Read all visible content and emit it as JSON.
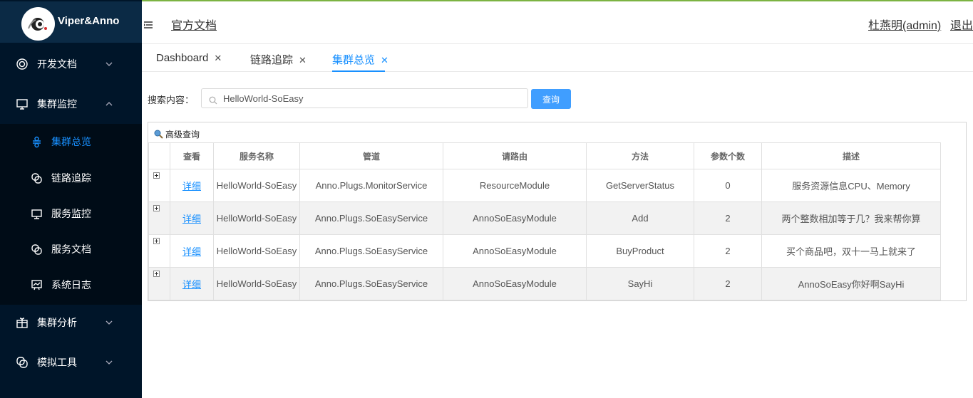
{
  "app": {
    "name": "Viper&Anno"
  },
  "colors": {
    "sidebar_bg": "#001529",
    "accent": "#1890ff",
    "button": "#409eff"
  },
  "sidebar": {
    "items": [
      {
        "label": "开发文档",
        "icon": "settings-circle-icon"
      },
      {
        "label": "集群监控",
        "icon": "monitor-icon",
        "expanded": true
      },
      {
        "label": "集群分析",
        "icon": "gift-icon"
      },
      {
        "label": "模拟工具",
        "icon": "link-icon"
      }
    ],
    "submenu": [
      {
        "label": "集群总览",
        "icon": "cluster-icon",
        "active": true
      },
      {
        "label": "链路追踪",
        "icon": "link-icon"
      },
      {
        "label": "服务监控",
        "icon": "monitor-icon"
      },
      {
        "label": "服务文档",
        "icon": "link-icon"
      },
      {
        "label": "系统日志",
        "icon": "chart-board-icon"
      }
    ]
  },
  "header": {
    "doc_link": "官方文档",
    "user": "杜燕明(admin)",
    "logout": "退出"
  },
  "tabs": [
    {
      "label": "Dashboard"
    },
    {
      "label": "链路追踪"
    },
    {
      "label": "集群总览",
      "active": true
    }
  ],
  "search": {
    "label": "搜索内容：",
    "value": "HelloWorld-SoEasy",
    "button": "查询"
  },
  "grid": {
    "advanced": "高级查询",
    "columns": [
      "查看",
      "服务名称",
      "管道",
      "请路由",
      "方法",
      "参数个数",
      "描述"
    ],
    "rows": [
      {
        "link": "详细",
        "service": "HelloWorld-SoEasy",
        "pipe": "Anno.Plugs.MonitorService",
        "route": "ResourceModule",
        "method": "GetServerStatus",
        "params": "0",
        "desc": "服务资源信息CPU、Memory"
      },
      {
        "link": "详细",
        "service": "HelloWorld-SoEasy",
        "pipe": "Anno.Plugs.SoEasyService",
        "route": "AnnoSoEasyModule",
        "method": "Add",
        "params": "2",
        "desc": "两个整数相加等于几？我来帮你算"
      },
      {
        "link": "详细",
        "service": "HelloWorld-SoEasy",
        "pipe": "Anno.Plugs.SoEasyService",
        "route": "AnnoSoEasyModule",
        "method": "BuyProduct",
        "params": "2",
        "desc": "买个商品吧，双十一马上就来了"
      },
      {
        "link": "详细",
        "service": "HelloWorld-SoEasy",
        "pipe": "Anno.Plugs.SoEasyService",
        "route": "AnnoSoEasyModule",
        "method": "SayHi",
        "params": "2",
        "desc": "AnnoSoEasy你好啊SayHi"
      }
    ]
  }
}
